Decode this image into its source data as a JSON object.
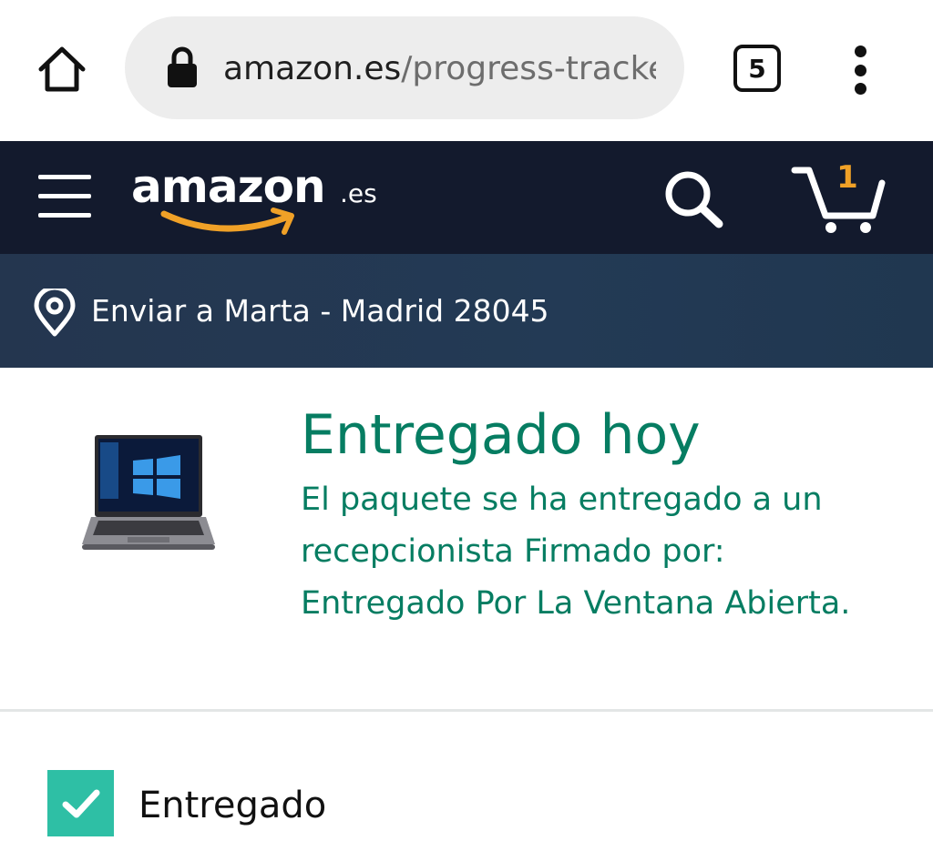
{
  "browser": {
    "url_domain": "amazon.es",
    "url_path": "/progress-tracke",
    "tab_count": "5",
    "icons": {
      "home": "home-icon",
      "lock": "lock-icon",
      "menu": "more-vert-icon"
    }
  },
  "header": {
    "logo_word": "amazon",
    "logo_tld": ".es",
    "cart_count": "1",
    "accent_color": "#f0a127",
    "background_color": "#131a2d",
    "icons": {
      "menu": "hamburger-icon",
      "search": "search-icon",
      "cart": "cart-icon"
    }
  },
  "deliver": {
    "text": "Enviar a Marta - Madrid 28045",
    "icon": "location-pin-icon"
  },
  "order": {
    "status_title": "Entregado hoy",
    "status_detail": "El paquete se ha entregado a un recepcionista Firmado por: Entregado Por La Ventana Abierta.",
    "status_color": "#067d62",
    "product_image": "laptop"
  },
  "timeline": {
    "steps": [
      {
        "label": "Entregado",
        "completed": true,
        "icon": "checkmark-icon",
        "color": "#2ebfa5"
      }
    ]
  }
}
